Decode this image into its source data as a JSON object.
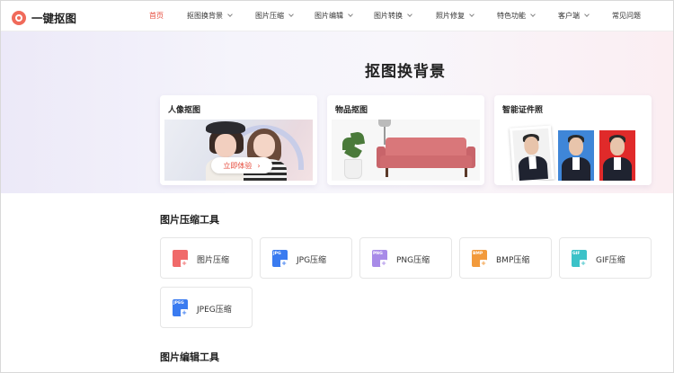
{
  "brand": {
    "name": "一键抠图"
  },
  "nav": {
    "items": [
      {
        "label": "首页",
        "active": true,
        "dropdown": false
      },
      {
        "label": "抠图换背景",
        "dropdown": true
      },
      {
        "label": "图片压缩",
        "dropdown": true
      },
      {
        "label": "图片编辑",
        "dropdown": true
      },
      {
        "label": "图片转换",
        "dropdown": true
      },
      {
        "label": "照片修复",
        "dropdown": true
      },
      {
        "label": "特色功能",
        "dropdown": true
      },
      {
        "label": "客户端",
        "dropdown": true
      },
      {
        "label": "常见问题",
        "dropdown": false
      }
    ]
  },
  "hero": {
    "title": "抠图换背景",
    "cards": [
      {
        "title": "人像抠图",
        "button": "立即体验"
      },
      {
        "title": "物品抠图"
      },
      {
        "title": "智能证件照"
      }
    ]
  },
  "compress": {
    "title": "图片压缩工具",
    "tools": [
      {
        "label": "图片压缩",
        "icon": "image-compress-icon",
        "tag": "",
        "color": "#f06a6a"
      },
      {
        "label": "JPG压缩",
        "icon": "jpg-file-icon",
        "tag": "JPG",
        "color": "#3a7bf0"
      },
      {
        "label": "PNG压缩",
        "icon": "png-file-icon",
        "tag": "PNG",
        "color": "#a88be8"
      },
      {
        "label": "BMP压缩",
        "icon": "bmp-file-icon",
        "tag": "BMP",
        "color": "#f29a3c"
      },
      {
        "label": "GIF压缩",
        "icon": "gif-file-icon",
        "tag": "GIF",
        "color": "#3cc2c8"
      },
      {
        "label": "JPEG压缩",
        "icon": "jpeg-file-icon",
        "tag": "JPEG",
        "color": "#3a7bf0"
      }
    ]
  },
  "edit": {
    "title": "图片编辑工具"
  },
  "colors": {
    "accent": "#e64b3c"
  }
}
